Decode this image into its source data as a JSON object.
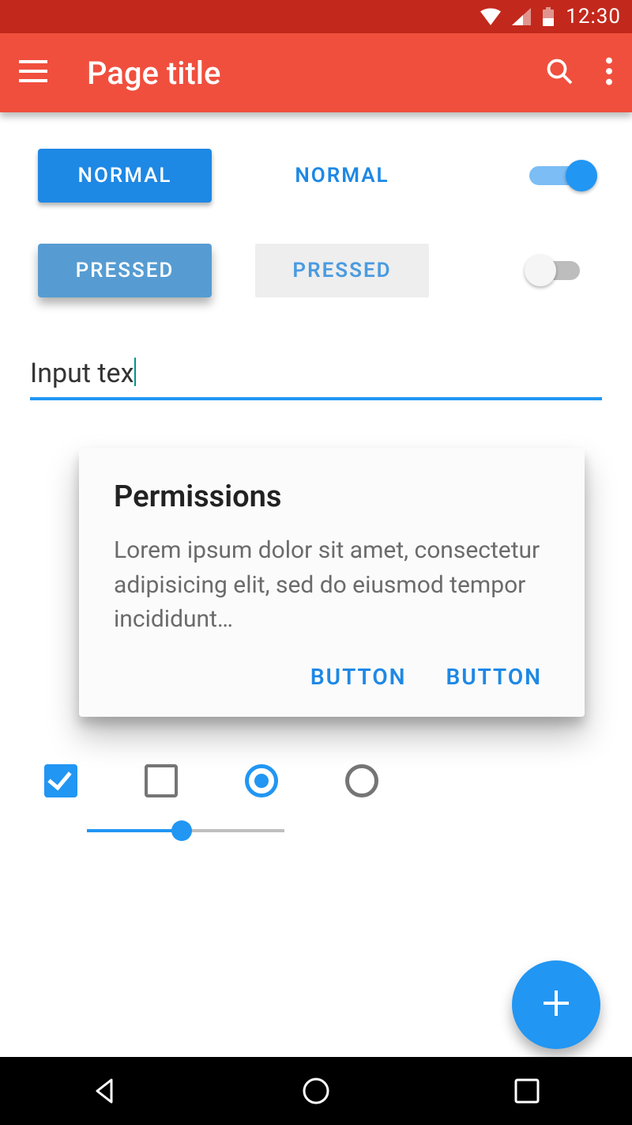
{
  "statusbar": {
    "time": "12:30"
  },
  "appbar": {
    "title": "Page title"
  },
  "buttons": {
    "raised_normal": "NORMAL",
    "raised_pressed": "PRESSED",
    "flat_normal": "NORMAL",
    "flat_pressed": "PRESSED"
  },
  "switches": {
    "top_on": true,
    "bottom_on": false
  },
  "input": {
    "value": "Input tex"
  },
  "dialog": {
    "title": "Permissions",
    "body": "Lorem ipsum dolor sit amet, consectetur adipisicing elit, sed do eiusmod tempor incididunt…",
    "action1": "BUTTON",
    "action2": "BUTTON"
  },
  "selectors": {
    "checkbox_checked": true,
    "checkbox_unchecked": false,
    "radio_selected": true,
    "radio_unselected": false
  },
  "slider": {
    "value_pct": 48
  },
  "colors": {
    "primary": "#f04f3e",
    "primary_dark": "#c3281c",
    "accent": "#2196f3"
  }
}
